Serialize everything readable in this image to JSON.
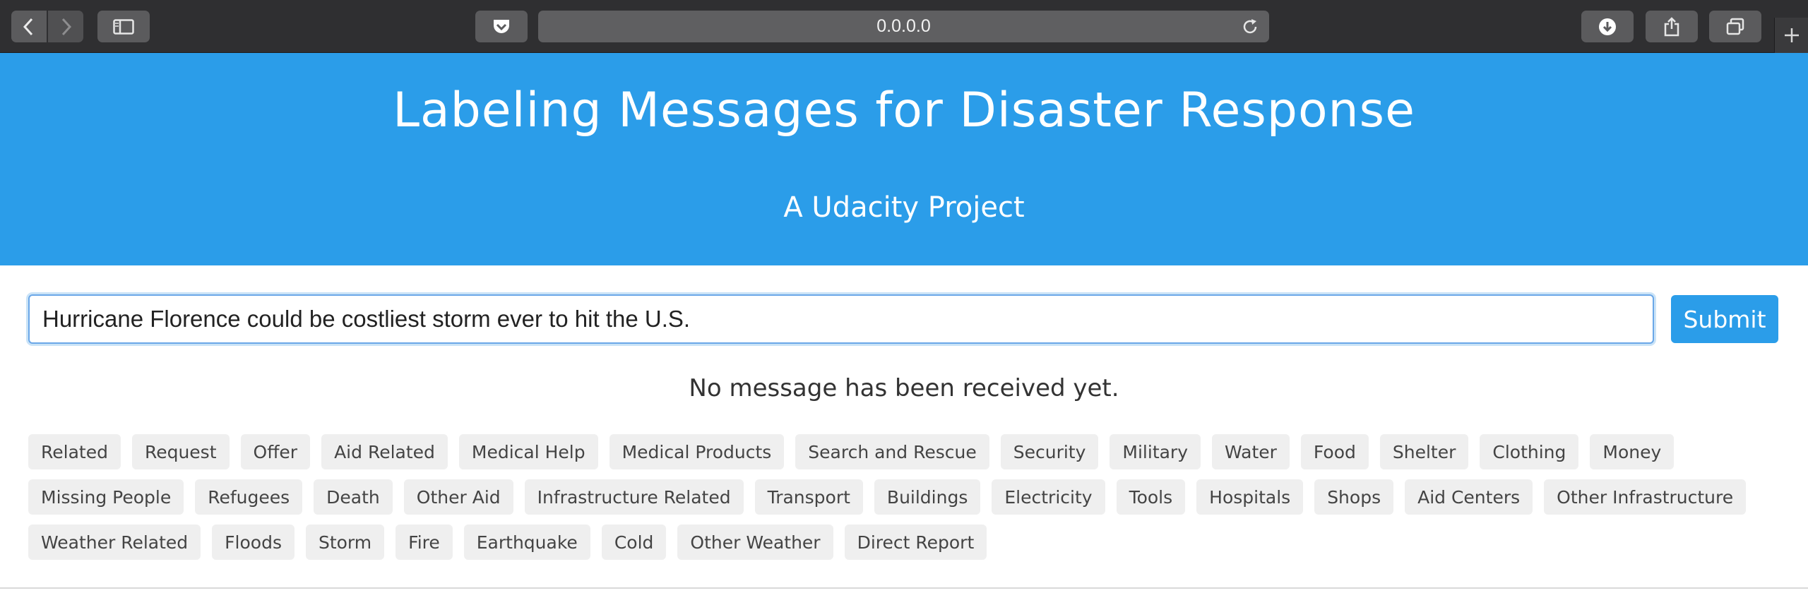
{
  "browser": {
    "url": "0.0.0.0",
    "icons": {
      "back": "chevron-left-icon",
      "forward": "chevron-right-icon",
      "sidebar": "sidebar-icon",
      "pocket": "pocket-icon",
      "reload": "reload-icon",
      "download": "download-icon",
      "share": "share-icon",
      "tabs": "tabs-overview-icon",
      "new_tab": "plus-icon"
    }
  },
  "header": {
    "title": "Labeling Messages for Disaster Response",
    "subtitle": "A Udacity Project"
  },
  "form": {
    "message_value": "Hurricane Florence could be costliest storm ever to hit the U.S.",
    "submit_label": "Submit"
  },
  "status": "No message has been received yet.",
  "categories": [
    "Related",
    "Request",
    "Offer",
    "Aid Related",
    "Medical Help",
    "Medical Products",
    "Search and Rescue",
    "Security",
    "Military",
    "Water",
    "Food",
    "Shelter",
    "Clothing",
    "Money",
    "Missing People",
    "Refugees",
    "Death",
    "Other Aid",
    "Infrastructure Related",
    "Transport",
    "Buildings",
    "Electricity",
    "Tools",
    "Hospitals",
    "Shops",
    "Aid Centers",
    "Other Infrastructure",
    "Weather Related",
    "Floods",
    "Storm",
    "Fire",
    "Earthquake",
    "Cold",
    "Other Weather",
    "Direct Report"
  ],
  "colors": {
    "brand_blue": "#2b9de9",
    "badge_bg": "#efefef",
    "chrome_bg": "#2f2f31"
  }
}
